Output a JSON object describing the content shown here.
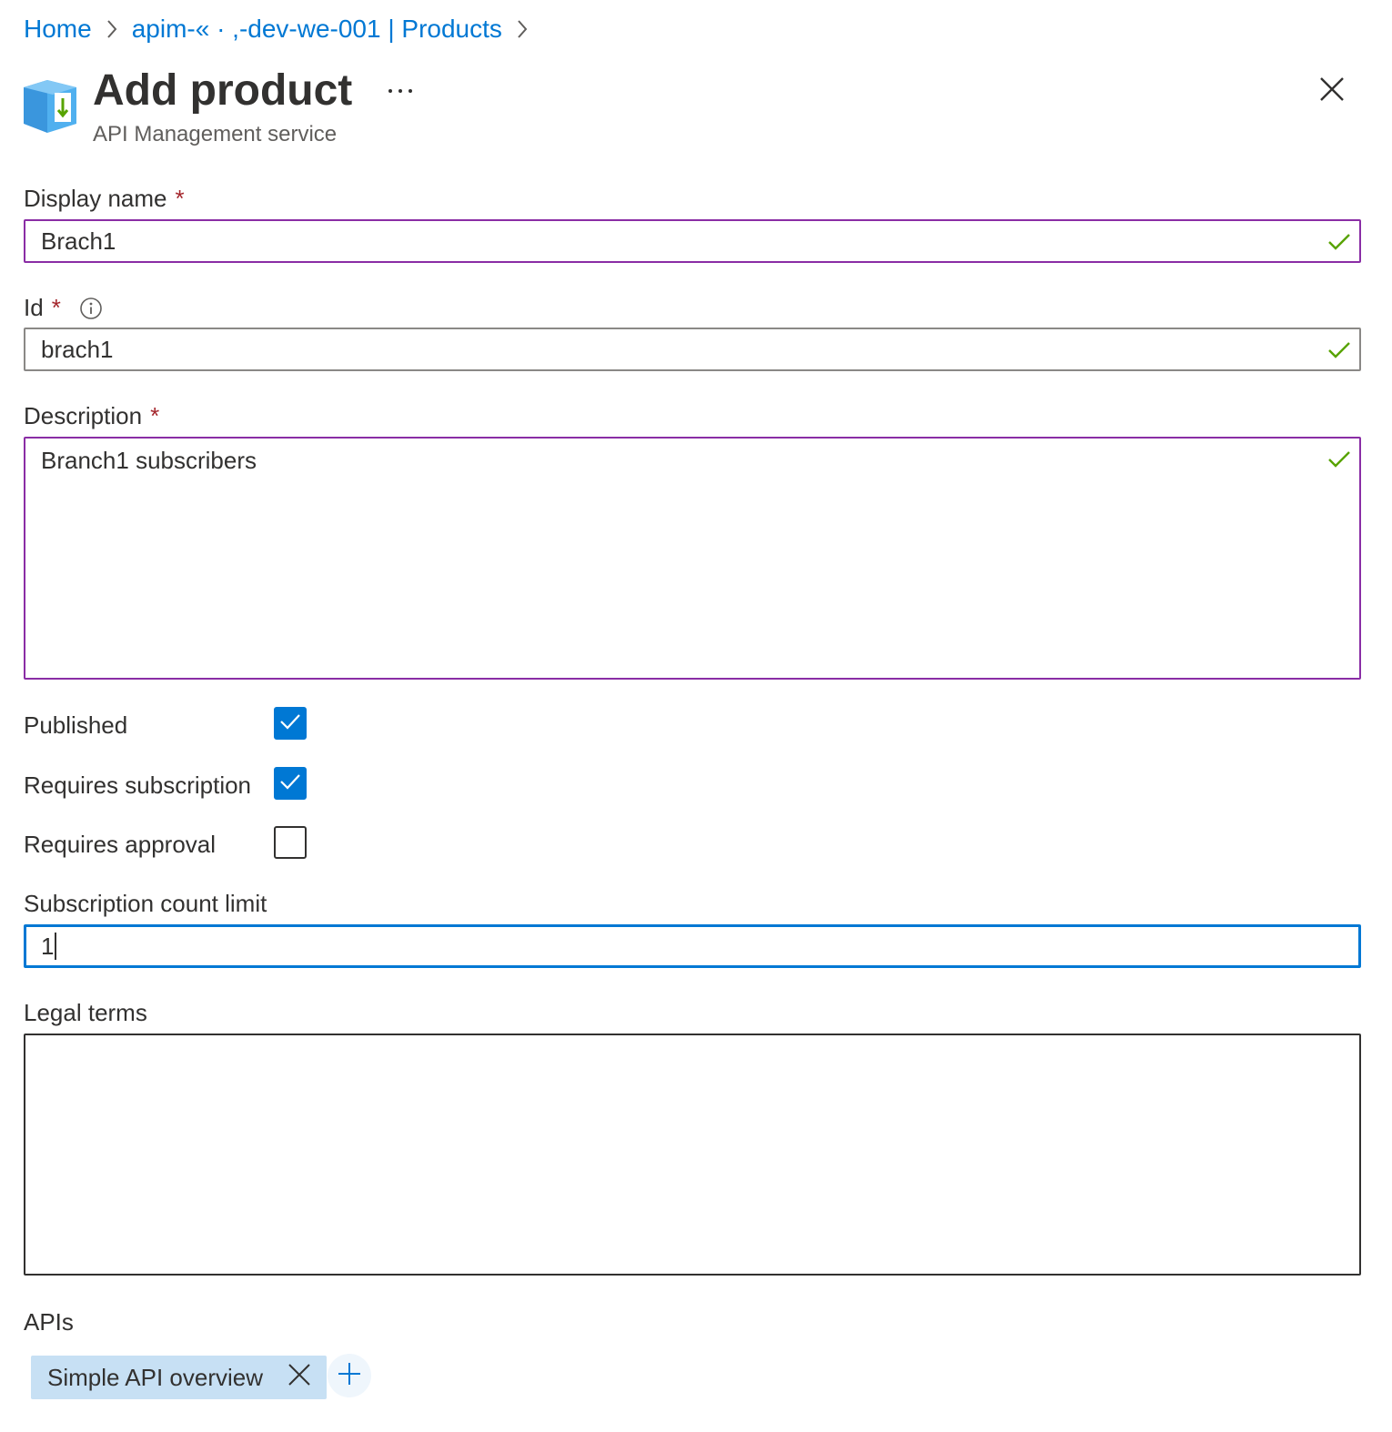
{
  "breadcrumb": {
    "items": [
      "Home",
      "apim-« · ,-dev-we-001 | Products"
    ]
  },
  "header": {
    "title": "Add product",
    "subtitle": "API Management service",
    "more_label": "···",
    "icons": {
      "service": "api-management-icon",
      "more": "more-options-icon",
      "close": "close-icon"
    }
  },
  "form": {
    "display_name": {
      "label": "Display name",
      "required_marker": "*",
      "value": "Brach1",
      "valid": true
    },
    "id": {
      "label": "Id",
      "required_marker": "*",
      "value": "brach1",
      "valid": true,
      "info_icon": "info-icon"
    },
    "description": {
      "label": "Description",
      "required_marker": "*",
      "value": "Branch1 subscribers",
      "valid": true
    },
    "published": {
      "label": "Published",
      "checked": true
    },
    "requires_subscription": {
      "label": "Requires subscription",
      "checked": true
    },
    "requires_approval": {
      "label": "Requires approval",
      "checked": false
    },
    "subscription_count_limit": {
      "label": "Subscription count limit",
      "value": "1"
    },
    "legal_terms": {
      "label": "Legal terms",
      "value": ""
    },
    "apis": {
      "label": "APIs",
      "items": [
        "Simple API overview"
      ],
      "add_icon": "plus-icon",
      "remove_icon": "close-icon"
    }
  },
  "colors": {
    "link": "#0078d4",
    "required": "#a4262c",
    "valid_check": "#57a300",
    "focus_border": "#0078d4",
    "hover_border": "#8a2da5",
    "chip_background": "#c7e0f4",
    "checkbox_checked": "#0078d4"
  }
}
